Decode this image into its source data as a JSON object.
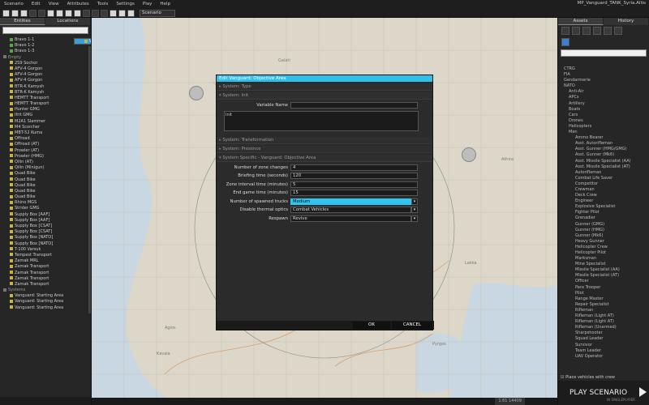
{
  "app": {
    "menu": [
      "Scenario",
      "Edit",
      "View",
      "Attributes",
      "Tools",
      "Settings",
      "Play",
      "Help"
    ],
    "title": "MP_Vanguard_TANK_Syria.Altis"
  },
  "toolbar": {
    "scenario_dropdown": "Scenario"
  },
  "left": {
    "tabs": [
      "Entities",
      "Locations"
    ],
    "tree": [
      {
        "label": "Bravo 1-1",
        "type": "green"
      },
      {
        "label": "Bravo 1-2",
        "type": "green"
      },
      {
        "label": "Bravo 1-3",
        "type": "green"
      },
      {
        "label": "Empty",
        "type": "hdr"
      },
      {
        "label": "2S9 Sochor",
        "type": "item"
      },
      {
        "label": "AFV-4 Gorgon",
        "type": "item"
      },
      {
        "label": "AFV-4 Gorgon",
        "type": "item"
      },
      {
        "label": "AFV-4 Gorgon",
        "type": "item"
      },
      {
        "label": "BTR-K Kamysh",
        "type": "item"
      },
      {
        "label": "BTR-K Kamysh",
        "type": "item"
      },
      {
        "label": "HEMTT Transport",
        "type": "item"
      },
      {
        "label": "HEMTT Transport",
        "type": "item"
      },
      {
        "label": "Hunter GMG",
        "type": "item"
      },
      {
        "label": "Ifrit GMG",
        "type": "item"
      },
      {
        "label": "M2A1 Slammer",
        "type": "item"
      },
      {
        "label": "M4 Scorcher",
        "type": "item"
      },
      {
        "label": "MBT-52 Kuma",
        "type": "item"
      },
      {
        "label": "Offroad",
        "type": "item"
      },
      {
        "label": "Offroad (AT)",
        "type": "item"
      },
      {
        "label": "Prowler (AT)",
        "type": "item"
      },
      {
        "label": "Prowler (HMG)",
        "type": "item"
      },
      {
        "label": "Qilin (AT)",
        "type": "item"
      },
      {
        "label": "Qilin (Minigun)",
        "type": "item"
      },
      {
        "label": "Quad Bike",
        "type": "item"
      },
      {
        "label": "Quad Bike",
        "type": "item"
      },
      {
        "label": "Quad Bike",
        "type": "item"
      },
      {
        "label": "Quad Bike",
        "type": "item"
      },
      {
        "label": "Quad Bike",
        "type": "item"
      },
      {
        "label": "Rhino MGS",
        "type": "item"
      },
      {
        "label": "Strider GMG",
        "type": "item"
      },
      {
        "label": "Supply Box [AAF]",
        "type": "item"
      },
      {
        "label": "Supply Box [AAF]",
        "type": "item"
      },
      {
        "label": "Supply Box [CSAT]",
        "type": "item"
      },
      {
        "label": "Supply Box [CSAT]",
        "type": "item"
      },
      {
        "label": "Supply Box [NATO]",
        "type": "item"
      },
      {
        "label": "Supply Box [NATO]",
        "type": "item"
      },
      {
        "label": "T-100 Varsuk",
        "type": "item"
      },
      {
        "label": "Tempest Transport",
        "type": "item"
      },
      {
        "label": "Zamak MRL",
        "type": "item"
      },
      {
        "label": "Zamak Transport",
        "type": "item"
      },
      {
        "label": "Zamak Transport",
        "type": "item"
      },
      {
        "label": "Zamak Transport",
        "type": "item"
      },
      {
        "label": "Zamak Transport",
        "type": "item"
      },
      {
        "label": "Systems",
        "type": "hdr"
      },
      {
        "label": "Vanguard: Objective Area",
        "type": "sel"
      },
      {
        "label": "Vanguard: Starting Area",
        "type": "item"
      },
      {
        "label": "Vanguard: Starting Area",
        "type": "item"
      },
      {
        "label": "Vanguard: Starting Area",
        "type": "item"
      }
    ]
  },
  "right": {
    "tabs": [
      "Assets",
      "History"
    ],
    "tree": [
      "CTRG",
      "FIA",
      "Gendarmerie",
      "NATO",
      "Anti-Air",
      "APCs",
      "Artillery",
      "Boats",
      "Cars",
      "Drones",
      "Helicopters",
      "Men",
      "Ammo Bearer",
      "Asst. Autorifleman",
      "Asst. Gunner (HMG/GMG)",
      "Asst. Gunner (Mk6)",
      "Asst. Missile Specialist (AA)",
      "Asst. Missile Specialist (AT)",
      "Autorifleman",
      "Combat Life Saver",
      "Competitor",
      "Crewman",
      "Deck Crew",
      "Engineer",
      "Explosive Specialist",
      "Fighter Pilot",
      "Grenadier",
      "Gunner (GMG)",
      "Gunner (HMG)",
      "Gunner (Mk6)",
      "Heavy Gunner",
      "Helicopter Crew",
      "Helicopter Pilot",
      "Marksman",
      "Mine Specialist",
      "Missile Specialist (AA)",
      "Missile Specialist (AT)",
      "Officer",
      "Para Trooper",
      "Pilot",
      "Range Master",
      "Repair Specialist",
      "Rifleman",
      "Rifleman (Light AT)",
      "Rifleman (Light AT)",
      "Rifleman (Unarmed)",
      "Sharpshooter",
      "Squad Leader",
      "Survivor",
      "Team Leader",
      "UAV Operator"
    ],
    "place_vehicles": "Place vehicles with crew",
    "play": "PLAY SCENARIO",
    "play_sub": "IN SINGLEPLAYER"
  },
  "map": {
    "labels": [
      "Athira",
      "Kavala",
      "Agios",
      "Lakka",
      "Pyrgos",
      "Galati"
    ]
  },
  "status": {
    "coords": "1.61 14409"
  },
  "dialog": {
    "title": "Edit Vanguard: Objective Area",
    "sections": [
      "System: Type",
      "System: Init",
      "System: Transformation",
      "System: Presence",
      "System Specific - Vanguard: Objective Area"
    ],
    "variable_name_label": "Variable Name",
    "variable_name": "",
    "init_label": "Init",
    "init_value": "",
    "fields": [
      {
        "label": "Number of zone changes",
        "value": "4"
      },
      {
        "label": "Briefing time (seconds)",
        "value": "120"
      },
      {
        "label": "Zone interval time (minutes)",
        "value": "5"
      },
      {
        "label": "End game time (minutes)",
        "value": "15"
      }
    ],
    "selects": [
      {
        "label": "Number of spawned trucks",
        "value": "Medium"
      },
      {
        "label": "Disable thermal optics",
        "value": "Combat Vehicles"
      },
      {
        "label": "Respawn",
        "value": "Revive"
      }
    ],
    "ok": "OK",
    "cancel": "CANCEL"
  }
}
